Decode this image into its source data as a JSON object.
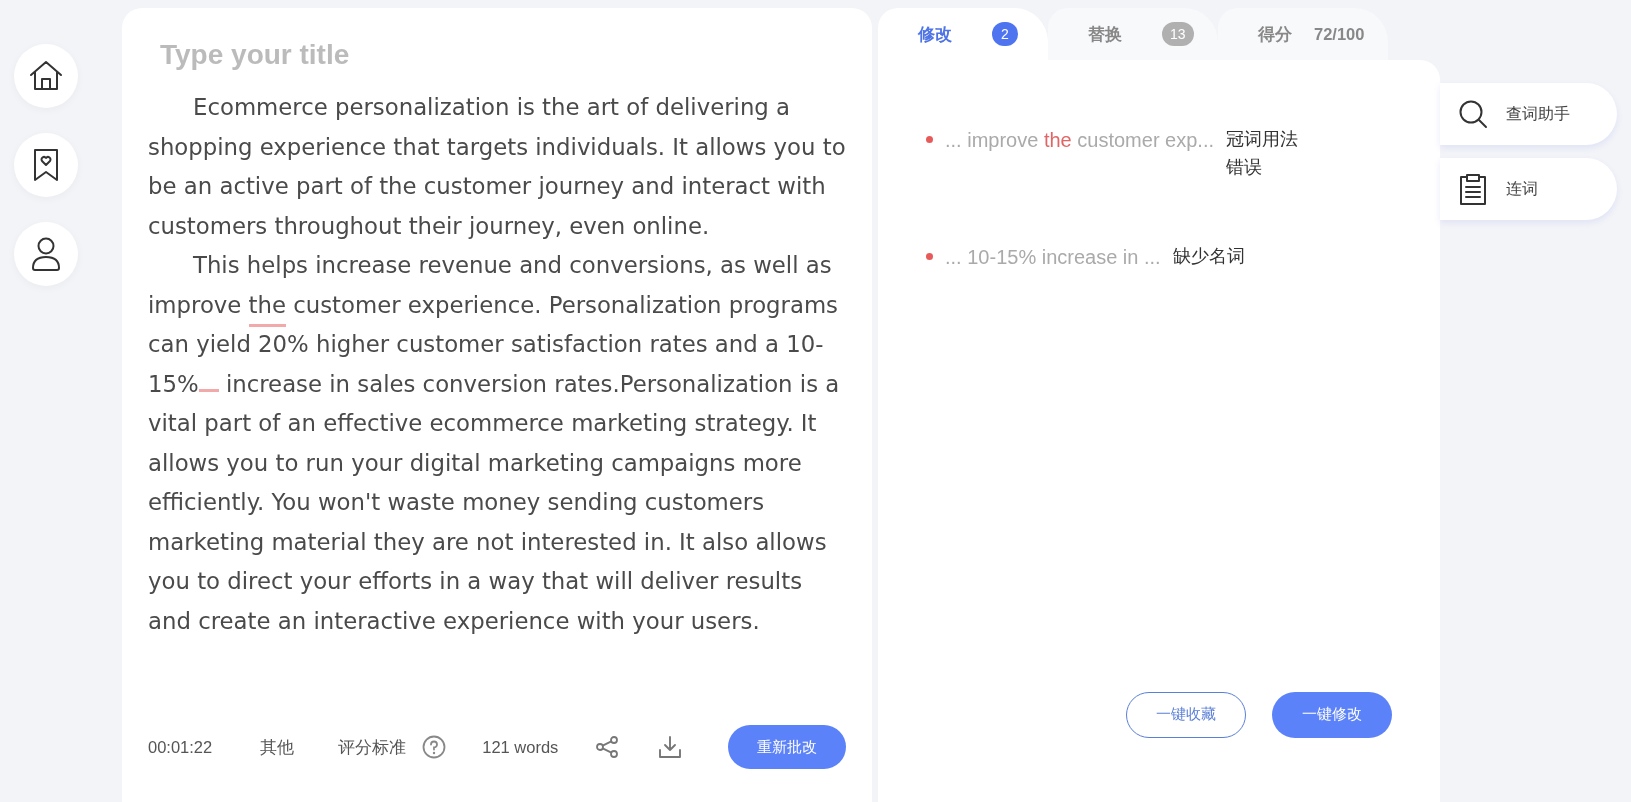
{
  "editor": {
    "title_placeholder": "Type your title",
    "paragraphs": [
      [
        {
          "text": "Ecommerce personalization is the art of delivering a shopping experience that targets individuals. It allows you to be an active part of the customer journey and interact with customers throughout their journey, even online.",
          "kind": "plain"
        }
      ],
      [
        {
          "text": "This helps increase revenue and conversions, as well as improve ",
          "kind": "plain"
        },
        {
          "text": "the",
          "kind": "wrong"
        },
        {
          "text": " customer experience. Personalization programs can yield 20% higher customer satisfaction rates and a 10-15%",
          "kind": "missing"
        },
        {
          "text": " increase in sales conversion rates.Personalization is a vital part of an effective ecommerce marketing strategy. It allows you to run your digital marketing campaigns more efficiently. You won't waste money sending customers marketing material they are not interested in. It also allows you to direct your efforts in a way that will deliver results and create an interactive experience with your users.",
          "kind": "plain"
        }
      ]
    ],
    "footer": {
      "timer": "00:01:22",
      "category": "其他",
      "criteria": "评分标准",
      "word_count": "121 words",
      "button": "重新批改"
    }
  },
  "tabs": [
    {
      "label": "修改",
      "kind": "badge",
      "count": "2",
      "selected": true
    },
    {
      "label": "替换",
      "kind": "badge",
      "count": "13",
      "selected": false
    },
    {
      "label": "得分",
      "kind": "score",
      "count": "72/100",
      "selected": false
    }
  ],
  "suggestions": [
    {
      "snippet": [
        {
          "text": "... improve ",
          "highlight": false
        },
        {
          "text": "the",
          "highlight": true
        },
        {
          "text": " customer exp...",
          "highlight": false
        }
      ],
      "issue": "冠词用法错误"
    },
    {
      "snippet": [
        {
          "text": "... 10-15% increase in ...",
          "highlight": false
        }
      ],
      "issue": "缺少名词"
    }
  ],
  "panel_buttons": [
    {
      "label": "一键收藏",
      "kind": "outline"
    },
    {
      "label": "一键修改",
      "kind": "solid"
    }
  ],
  "tools": [
    {
      "label": "查词助手"
    },
    {
      "label": "连词"
    }
  ]
}
